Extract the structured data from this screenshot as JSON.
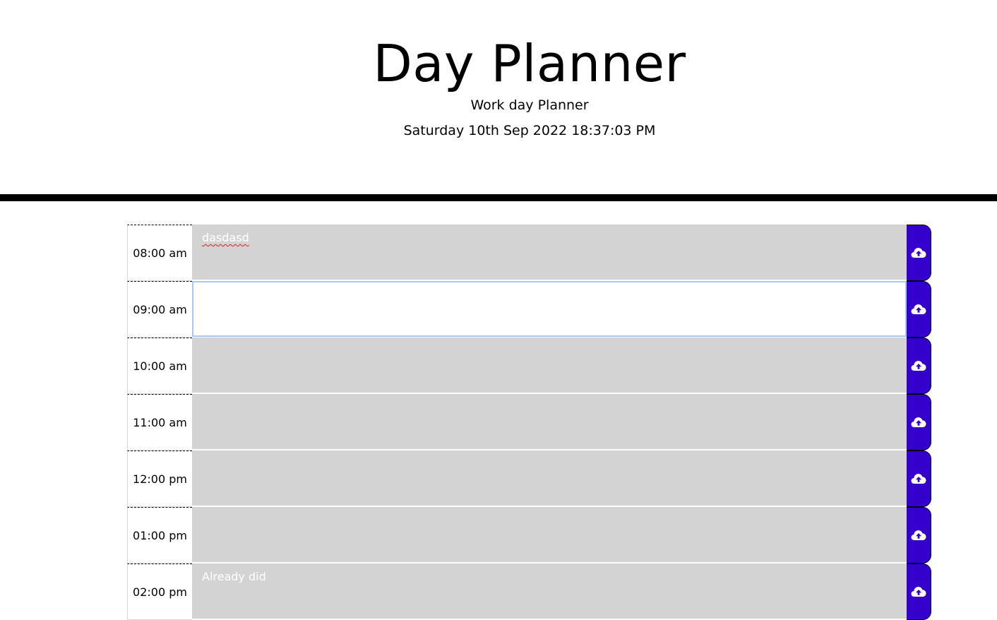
{
  "header": {
    "title": "Day Planner",
    "subtitle": "Work day Planner",
    "datetime": "Saturday 10th Sep 2022 18:37:03 PM"
  },
  "colors": {
    "save_button": "#3300cc",
    "past_slot": "#d3d3d3",
    "active_slot": "#ffffff"
  },
  "rows": [
    {
      "hour": "08:00 am",
      "text": "dasdasd",
      "state": "past",
      "save_icon": "cloud-upload-icon"
    },
    {
      "hour": "09:00 am",
      "text": "",
      "state": "active",
      "save_icon": "cloud-upload-icon"
    },
    {
      "hour": "10:00 am",
      "text": "",
      "state": "past",
      "save_icon": "cloud-upload-icon"
    },
    {
      "hour": "11:00 am",
      "text": "",
      "state": "past",
      "save_icon": "cloud-upload-icon"
    },
    {
      "hour": "12:00 pm",
      "text": "",
      "state": "past",
      "save_icon": "cloud-upload-icon"
    },
    {
      "hour": "01:00 pm",
      "text": "",
      "state": "past",
      "save_icon": "cloud-upload-icon"
    },
    {
      "hour": "02:00 pm",
      "text": "Already did",
      "state": "past",
      "save_icon": "cloud-upload-icon"
    }
  ]
}
